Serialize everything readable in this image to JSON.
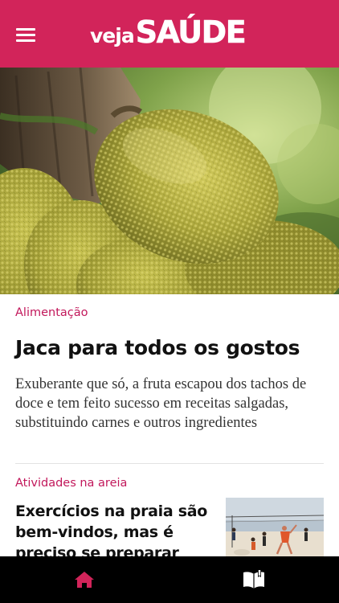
{
  "header": {
    "brand_prefix": "veja",
    "brand_name": "SAÚDE",
    "background_color": "#d2245a",
    "menu_icon": "hamburger-menu-icon"
  },
  "lead_article": {
    "image": "jackfruit-photo",
    "category": "Alimentação",
    "title": "Jaca para todos os gostos",
    "summary": "Exuberante que só, a fruta escapou dos tachos de doce e tem feito sucesso em receitas salgadas, substituindo carnes e outros ingredientes"
  },
  "second_article": {
    "category": "Atividades na areia",
    "title": "Exercícios na praia são bem-vindos, mas é preciso se preparar",
    "thumbnail": "beach-volleyball-photo"
  },
  "tabbar": {
    "tabs": [
      {
        "icon": "home-icon",
        "active": true
      },
      {
        "icon": "open-book-icon",
        "active": false
      }
    ],
    "active_color": "#d2245a",
    "inactive_color": "#ffffff"
  }
}
